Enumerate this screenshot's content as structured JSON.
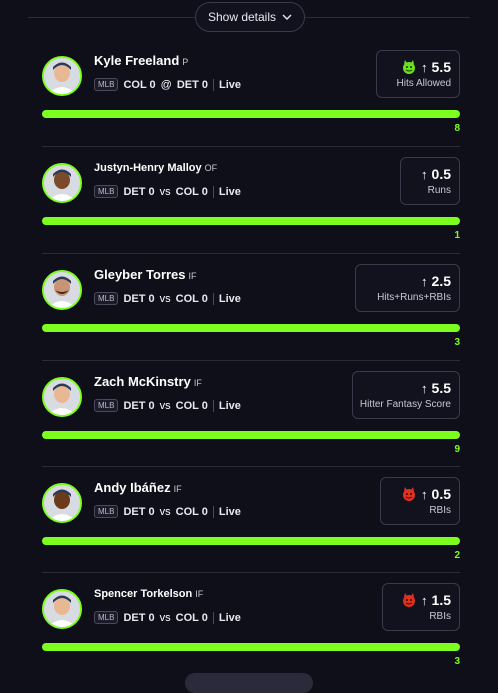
{
  "header": {
    "show_details": "Show details"
  },
  "players": [
    {
      "name": "Kyle Freeland",
      "pos": "P",
      "league": "MLB",
      "team1": "COL",
      "score1": "0",
      "sep": "@",
      "team2": "DET",
      "score2": "0",
      "status": "Live",
      "line": "5.5",
      "direction": "up",
      "stat": "Hits Allowed",
      "emoji": "devil-green",
      "current": "8"
    },
    {
      "name": "Justyn-Henry Malloy",
      "pos": "OF",
      "league": "MLB",
      "team1": "DET",
      "score1": "0",
      "sep": "vs",
      "team2": "COL",
      "score2": "0",
      "status": "Live",
      "line": "0.5",
      "direction": "up",
      "stat": "Runs",
      "emoji": "",
      "current": "1"
    },
    {
      "name": "Gleyber Torres",
      "pos": "IF",
      "league": "MLB",
      "team1": "DET",
      "score1": "0",
      "sep": "vs",
      "team2": "COL",
      "score2": "0",
      "status": "Live",
      "line": "2.5",
      "direction": "up",
      "stat": "Hits+Runs+RBIs",
      "emoji": "",
      "current": "3"
    },
    {
      "name": "Zach McKinstry",
      "pos": "IF",
      "league": "MLB",
      "team1": "DET",
      "score1": "0",
      "sep": "vs",
      "team2": "COL",
      "score2": "0",
      "status": "Live",
      "line": "5.5",
      "direction": "up",
      "stat": "Hitter Fantasy Score",
      "emoji": "",
      "current": "9"
    },
    {
      "name": "Andy Ibáñez",
      "pos": "IF",
      "league": "MLB",
      "team1": "DET",
      "score1": "0",
      "sep": "vs",
      "team2": "COL",
      "score2": "0",
      "status": "Live",
      "line": "0.5",
      "direction": "up",
      "stat": "RBIs",
      "emoji": "devil-red",
      "current": "2"
    },
    {
      "name": "Spencer Torkelson",
      "pos": "IF",
      "league": "MLB",
      "team1": "DET",
      "score1": "0",
      "sep": "vs",
      "team2": "COL",
      "score2": "0",
      "status": "Live",
      "line": "1.5",
      "direction": "up",
      "stat": "RBIs",
      "emoji": "devil-red",
      "current": "3"
    }
  ],
  "colors": {
    "accent": "#7cff1f",
    "background": "#0f0f1a",
    "card_border": "#3a3a4c"
  },
  "icons": {
    "dropdown": "chevron-down-icon",
    "arrow": "arrow-up-icon",
    "avatar": "player-headshot"
  }
}
